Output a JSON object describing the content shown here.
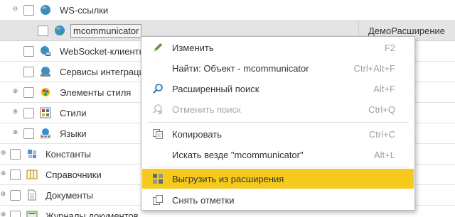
{
  "colors": {
    "highlight": "#f6ca1d",
    "selected_row": "#e4e4e4",
    "disabled_text": "#a6a6a6"
  },
  "tree": {
    "rows": [
      {
        "label": "WS-ссылки",
        "expander": "⊖",
        "icon": "globe-icon"
      },
      {
        "label": "mcommunicator",
        "icon": "globe-icon",
        "extension": "ДемоРасширение",
        "selected": true
      },
      {
        "label": "WebSocket-клиенты",
        "icon": "websocket-client-icon"
      },
      {
        "label": "Сервисы интеграции",
        "icon": "integration-service-icon"
      },
      {
        "label": "Элементы стиля",
        "expander": "⊕",
        "icon": "style-item-icon"
      },
      {
        "label": "Стили",
        "expander": "⊕",
        "icon": "style-icon"
      },
      {
        "label": "Языки",
        "expander": "⊕",
        "icon": "language-icon"
      },
      {
        "label": "Константы",
        "expander": "⊕",
        "icon": "constants-icon"
      },
      {
        "label": "Справочники",
        "expander": "⊕",
        "icon": "catalogs-icon"
      },
      {
        "label": "Документы",
        "expander": "⊕",
        "icon": "documents-icon"
      },
      {
        "label": "Журналы документов",
        "expander": "⊕",
        "icon": "document-journals-icon"
      }
    ]
  },
  "context_menu": {
    "items": [
      {
        "label": "Изменить",
        "shortcut": "F2",
        "icon": "pencil-icon"
      },
      {
        "label": "Найти: Объект - mcommunicator",
        "shortcut": "Ctrl+Alt+F"
      },
      {
        "label": "Расширенный поиск",
        "shortcut": "Alt+F",
        "icon": "magnifier-icon"
      },
      {
        "label": "Отменить поиск",
        "shortcut": "Ctrl+Q",
        "icon": "cancel-search-icon",
        "disabled": true
      },
      {
        "label": "Копировать",
        "shortcut": "Ctrl+C",
        "icon": "copy-icon"
      },
      {
        "label": "Искать везде \"mcommunicator\"",
        "shortcut": "Alt+L"
      },
      {
        "label": "Выгрузить из расширения",
        "icon": "unload-grid-icon",
        "highlighted": true
      },
      {
        "label": "Снять отметки",
        "icon": "uncheck-icon"
      }
    ]
  }
}
